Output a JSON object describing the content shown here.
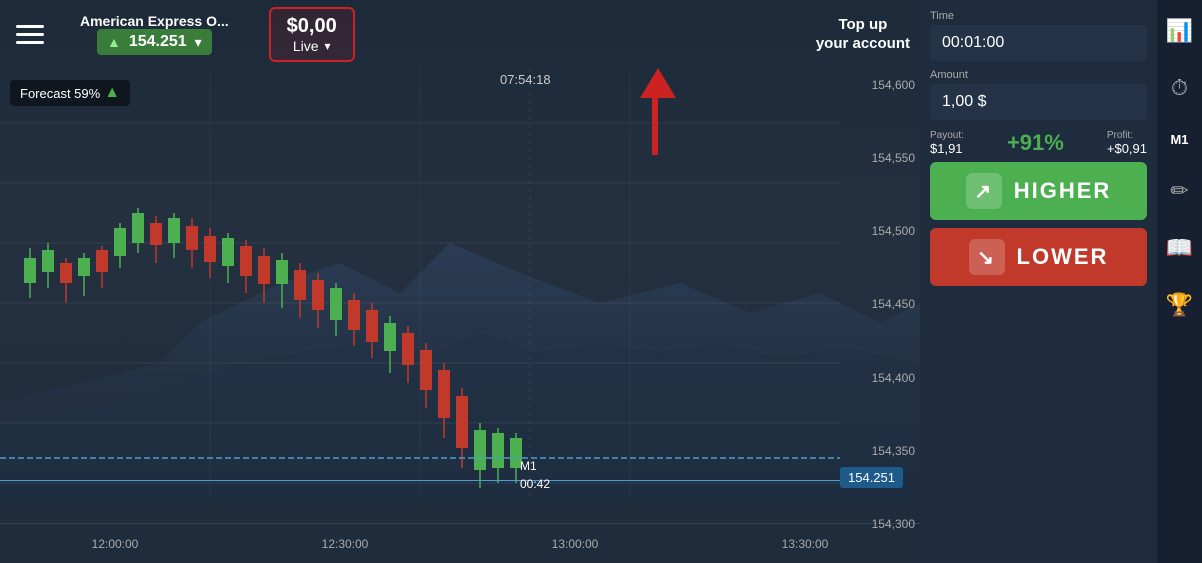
{
  "header": {
    "asset_name": "American Express O...",
    "asset_price": "154.251",
    "balance_amount": "$0,00",
    "balance_type": "Live",
    "topup_label": "Top up\nyour account",
    "forecast_label": "Forecast 59%"
  },
  "controls": {
    "time_label": "Time",
    "time_value": "00:01:00",
    "amount_label": "Amount",
    "amount_value": "1,00 $",
    "payout_label": "Payout:",
    "payout_value": "$1,91",
    "profit_label": "Profit:",
    "profit_value": "+$0,91",
    "payout_pct": "+91%",
    "higher_label": "HIGHER",
    "lower_label": "LOWER",
    "m1_label": "M1",
    "time_remaining": "00:42"
  },
  "chart": {
    "time_marker": "07:54:18",
    "x_labels": [
      "12:00:00",
      "12:30:00",
      "13:00:00",
      "13:30:00"
    ],
    "y_labels": [
      "154,600",
      "154,550",
      "154,500",
      "154,450",
      "154,400",
      "154,350",
      "154,300"
    ],
    "current_price": "154.251"
  },
  "icons": {
    "hamburger": "☰",
    "chart_icon": "📊",
    "clock_icon": "🕐",
    "edit_icon": "✏",
    "book_icon": "📖",
    "trophy_icon": "🏆",
    "bars_icon": "▐▌"
  }
}
